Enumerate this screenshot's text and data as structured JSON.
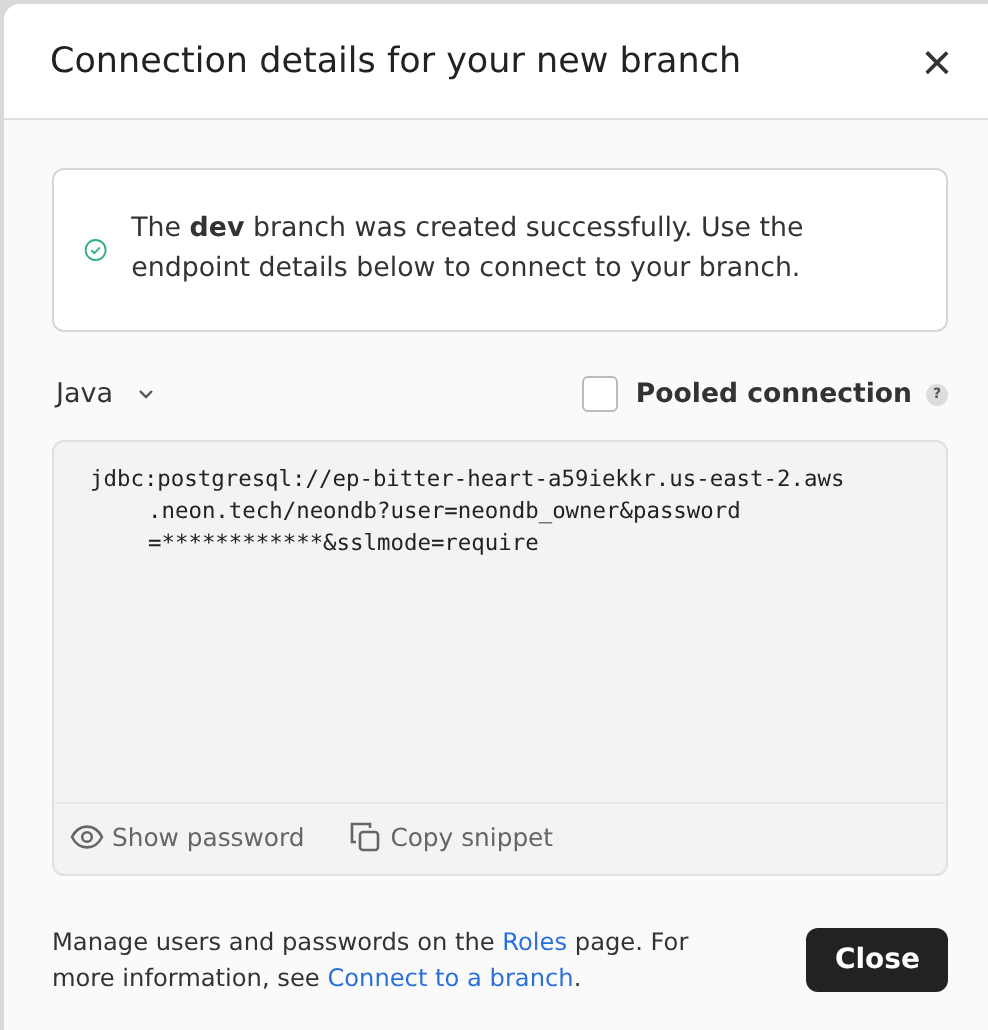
{
  "dialog": {
    "title": "Connection details for your new branch",
    "close_symbol": "×"
  },
  "alert": {
    "text": "The **dev** branch was created successfully. Use the endpoint details below to connect to your branch."
  },
  "language": {
    "value": "Java"
  },
  "pooled": {
    "label": "Pooled connection",
    "checked": false,
    "help": "?"
  },
  "snippet": {
    "lines": [
      "jdbc:postgresql://ep-bitter-heart-a59iekkr.us-east-2.aws",
      ".neon.tech/neondb?user=neondb_owner&password",
      "=************&sslmode=require"
    ]
  },
  "actions": [
    {
      "kind": "show",
      "label": "Show password"
    },
    {
      "kind": "copy",
      "label": "Copy snippet"
    }
  ],
  "footer": [
    {
      "kind": "text",
      "text": "Manage users and passwords on the "
    },
    {
      "kind": "link",
      "text": "Roles"
    },
    {
      "kind": "text",
      "text": " page. For more information, see "
    },
    {
      "kind": "link",
      "text": "Connect to a branch"
    },
    {
      "kind": "text",
      "text": "."
    }
  ],
  "buttons": [
    {
      "label": "Close"
    }
  ]
}
